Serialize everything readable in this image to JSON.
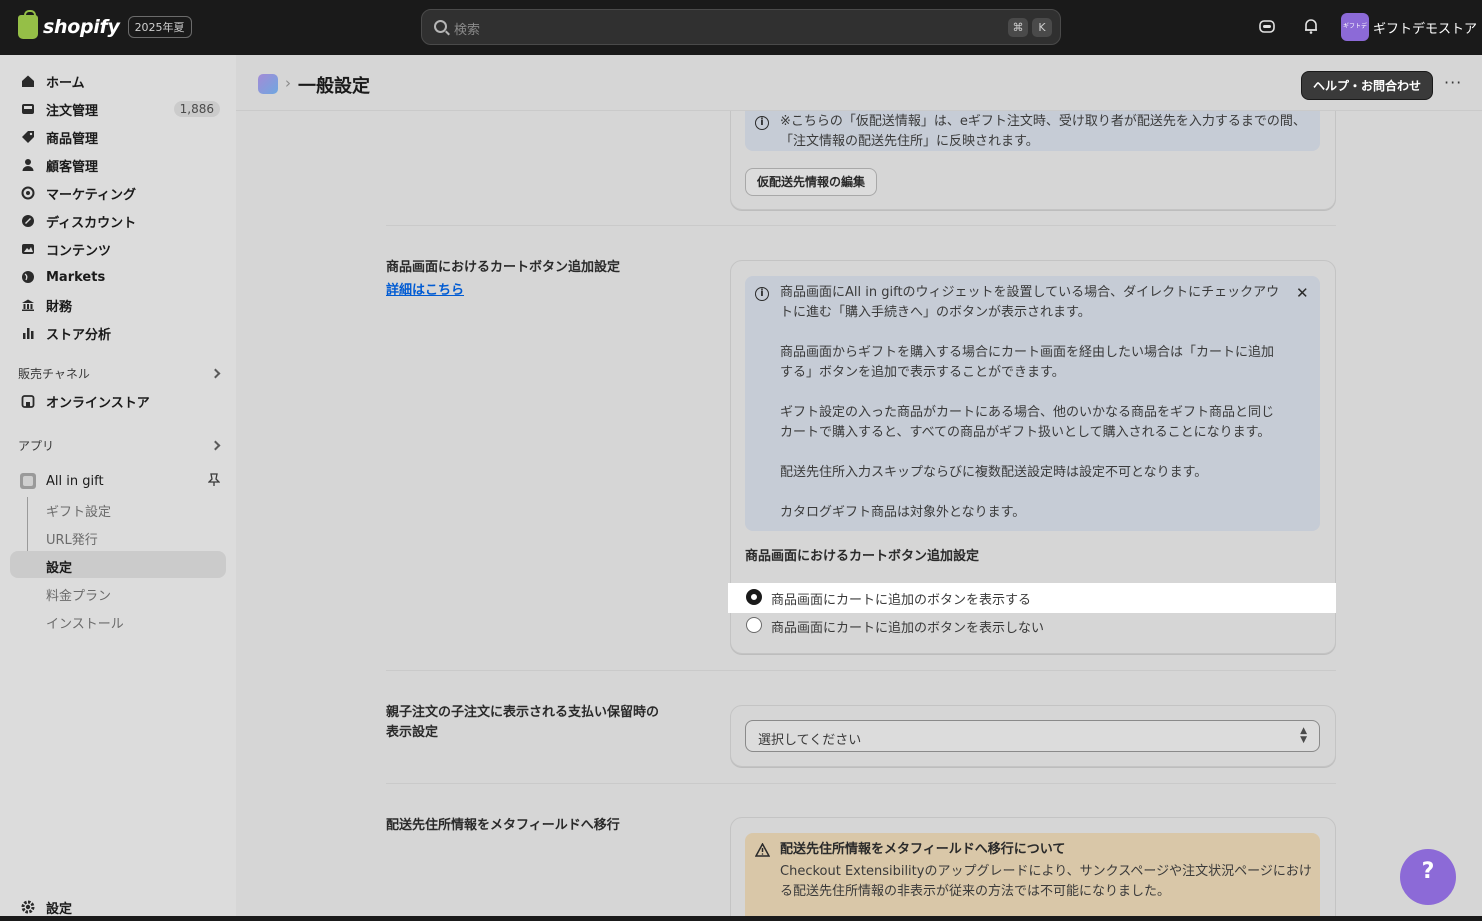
{
  "topbar": {
    "logo_text": "shopify",
    "edition": "2025年夏",
    "search_placeholder": "検索",
    "shortcut_cmd": "⌘",
    "shortcut_key": "K",
    "store_avatar": "ギフトデモ",
    "store_name": "ギフトデモストア"
  },
  "sidebar": {
    "items": [
      {
        "label": "ホーム",
        "icon": "home-icon"
      },
      {
        "label": "注文管理",
        "icon": "inbox-icon",
        "count": "1,886"
      },
      {
        "label": "商品管理",
        "icon": "tag-icon"
      },
      {
        "label": "顧客管理",
        "icon": "person-icon"
      },
      {
        "label": "マーケティング",
        "icon": "target-icon"
      },
      {
        "label": "ディスカウント",
        "icon": "discount-icon"
      },
      {
        "label": "コンテンツ",
        "icon": "image-icon"
      },
      {
        "label": "Markets",
        "icon": "globe-icon"
      },
      {
        "label": "財務",
        "icon": "bank-icon"
      },
      {
        "label": "ストア分析",
        "icon": "chart-icon"
      }
    ],
    "sales_channels": "販売チャネル",
    "online_store": "オンラインストア",
    "apps": "アプリ",
    "app_name": "All in gift",
    "app_subitems": [
      "ギフト設定",
      "URL発行",
      "設定",
      "料金プラン",
      "インストール"
    ],
    "settings": "設定"
  },
  "header": {
    "title": "一般設定",
    "help_button": "ヘルプ・お問合わせ"
  },
  "sections": {
    "top_banner_line1": "※こちらの「仮配送情報」は、eギフト注文時、受け取り者が配送先を入力するまでの間、",
    "top_banner_line2": "「注文情報の配送先住所」に反映されます。",
    "edit_button": "仮配送先情報の編集",
    "cart": {
      "label": "商品画面におけるカートボタン追加設定",
      "link": "詳細はこちら",
      "info_lines": [
        "商品画面にAll in giftのウィジェットを設置している場合、ダイレクトにチェックアウ",
        "トに進む「購入手続きへ」のボタンが表示されます。",
        "商品画面からギフトを購入する場合にカート画面を経由したい場合は「カートに追加",
        "する」ボタンを追加で表示することができます。",
        "ギフト設定の入った商品がカートにある場合、他のいかなる商品をギフト商品と同じ",
        "カートで購入すると、すべての商品がギフト扱いとして購入されることになります。",
        "配送先住所入力スキップならびに複数配送設定時は設定不可となります。",
        "カタログギフト商品は対象外となります。"
      ],
      "group_title": "商品画面におけるカートボタン追加設定",
      "option_show": "商品画面にカートに追加のボタンを表示する",
      "option_hide": "商品画面にカートに追加のボタンを表示しない",
      "selected": "option_show"
    },
    "payment_hold": {
      "label_line1": "親子注文の子注文に表示される支払い保留時の",
      "label_line2": "表示設定",
      "select_placeholder": "選択してください"
    },
    "metafield": {
      "label": "配送先住所情報をメタフィールドへ移行",
      "warn_title": "配送先住所情報をメタフィールドへ移行について",
      "warn_line1": "Checkout Extensibilityのアップグレードにより、サンクスページや注文状況ページにおけ",
      "warn_line2": "る配送先住所情報の非表示が従来の方法では不可能になりました。"
    }
  },
  "colors": {
    "accent_purple": "#8c6ad7",
    "link_blue": "#005bd3",
    "topbar": "#1a1a1a"
  }
}
